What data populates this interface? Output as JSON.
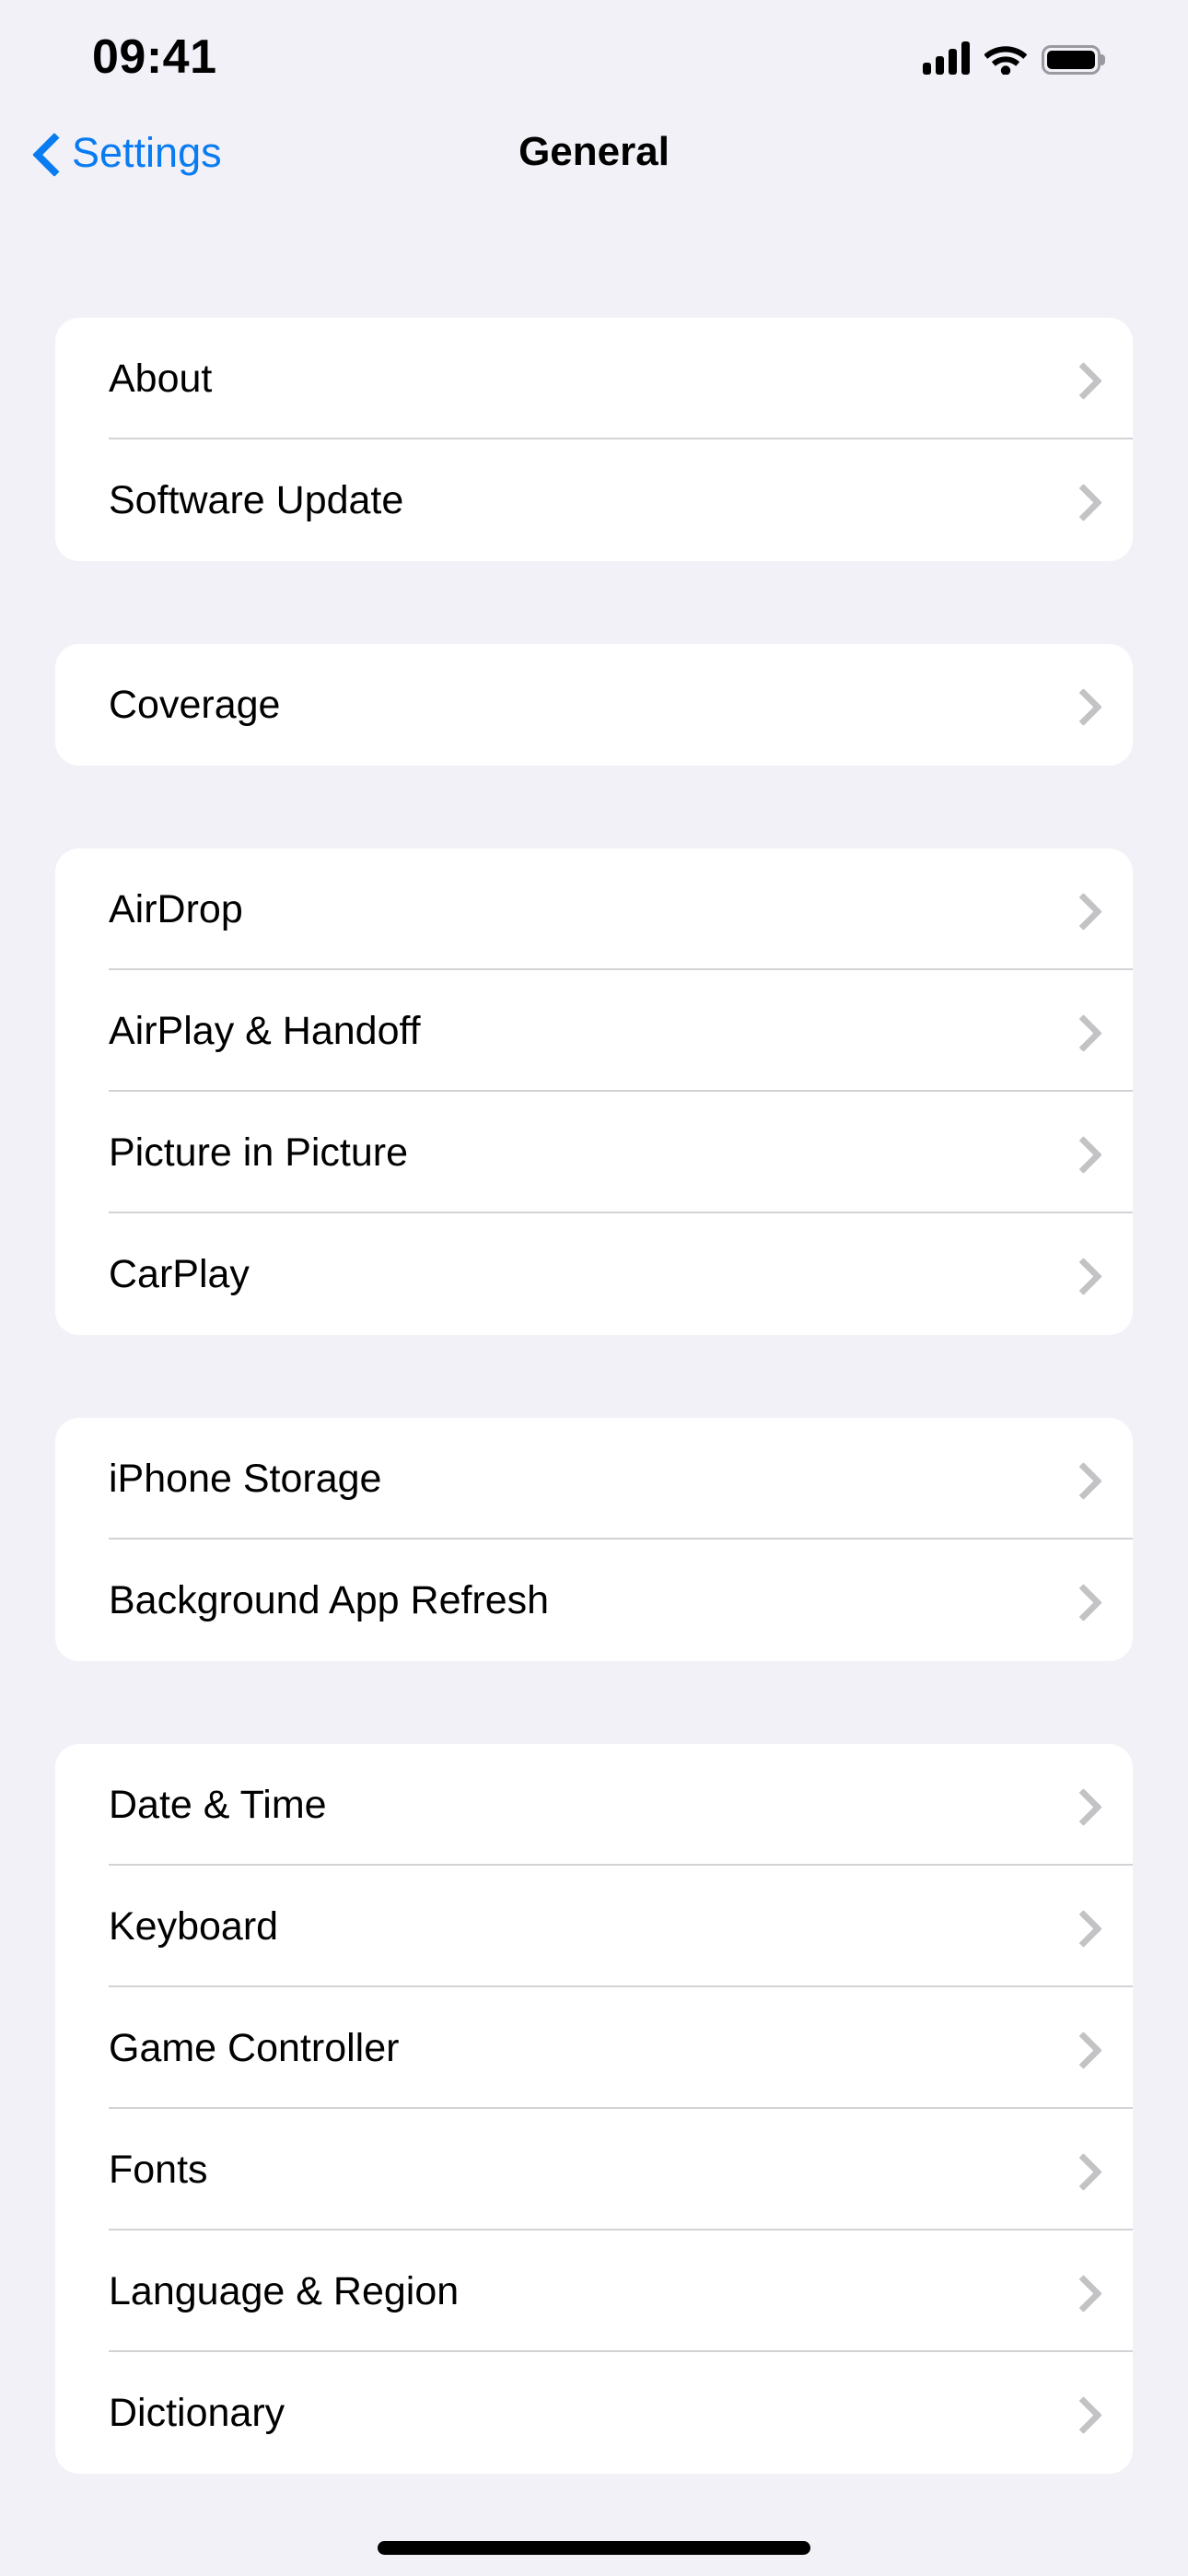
{
  "status_bar": {
    "time": "09:41",
    "cellular_icon": "cellular-signal-icon",
    "wifi_icon": "wifi-icon",
    "battery_icon": "battery-icon"
  },
  "nav": {
    "back_label": "Settings",
    "back_icon": "chevron-left-icon",
    "title": "General"
  },
  "colors": {
    "background": "#F2F1F7",
    "card": "#FFFFFF",
    "accent_blue": "#0A7CF1",
    "separator": "#D3D3D6",
    "chevron": "#C3C3C6",
    "label": "#000000"
  },
  "groups": [
    {
      "rows": [
        {
          "label": "About",
          "accessory": "chevron-right-icon"
        },
        {
          "label": "Software Update",
          "accessory": "chevron-right-icon"
        }
      ]
    },
    {
      "rows": [
        {
          "label": "Coverage",
          "accessory": "chevron-right-icon"
        }
      ]
    },
    {
      "rows": [
        {
          "label": "AirDrop",
          "accessory": "chevron-right-icon"
        },
        {
          "label": "AirPlay & Handoff",
          "accessory": "chevron-right-icon"
        },
        {
          "label": "Picture in Picture",
          "accessory": "chevron-right-icon"
        },
        {
          "label": "CarPlay",
          "accessory": "chevron-right-icon"
        }
      ]
    },
    {
      "rows": [
        {
          "label": "iPhone Storage",
          "accessory": "chevron-right-icon"
        },
        {
          "label": "Background App Refresh",
          "accessory": "chevron-right-icon"
        }
      ]
    },
    {
      "rows": [
        {
          "label": "Date & Time",
          "accessory": "chevron-right-icon"
        },
        {
          "label": "Keyboard",
          "accessory": "chevron-right-icon"
        },
        {
          "label": "Game Controller",
          "accessory": "chevron-right-icon"
        },
        {
          "label": "Fonts",
          "accessory": "chevron-right-icon"
        },
        {
          "label": "Language & Region",
          "accessory": "chevron-right-icon"
        },
        {
          "label": "Dictionary",
          "accessory": "chevron-right-icon"
        }
      ]
    }
  ],
  "home_indicator": "home-indicator"
}
